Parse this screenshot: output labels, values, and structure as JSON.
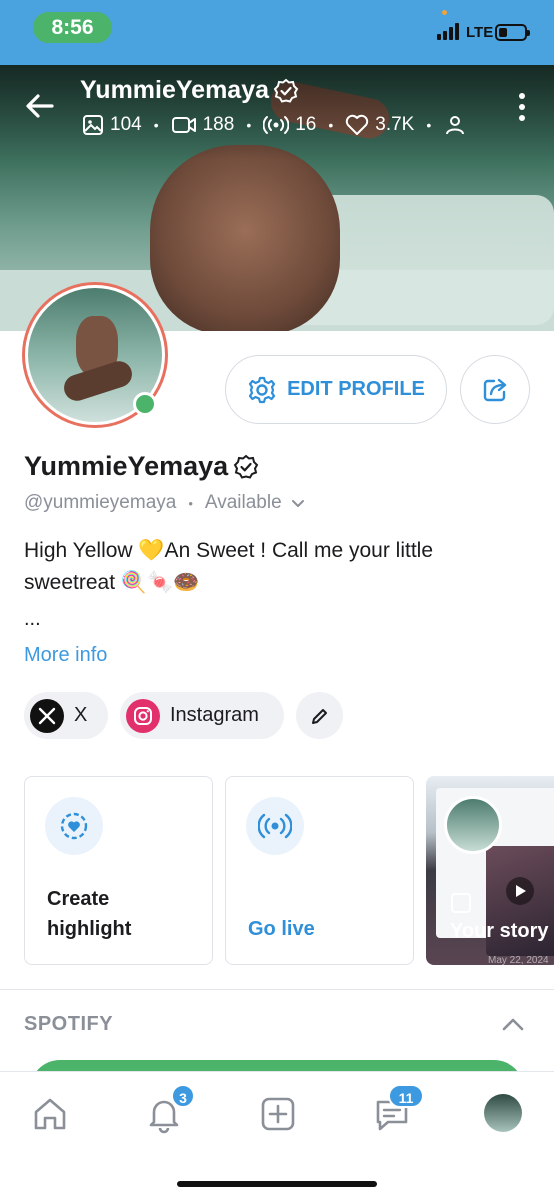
{
  "status_bar": {
    "time": "8:56",
    "network": "LTE"
  },
  "header": {
    "display_name": "YummieYemaya",
    "stats": {
      "photos": "104",
      "videos": "188",
      "streams": "16",
      "likes": "3.7K"
    }
  },
  "profile": {
    "display_name": "YummieYemaya",
    "handle": "@yummieyemaya",
    "availability": "Available",
    "bio_line1": "High Yellow 💛An Sweet ! Call me your little",
    "bio_line2": "sweetreat 🍭🍬🍩",
    "ellipsis": "...",
    "more_info": "More info",
    "edit_profile_label": "EDIT PROFILE"
  },
  "socials": [
    {
      "label": "X"
    },
    {
      "label": "Instagram"
    }
  ],
  "cards": {
    "highlight_line1": "Create",
    "highlight_line2": "highlight",
    "live": "Go live",
    "story": "Your story",
    "story_date": "May 22, 2024"
  },
  "spotify": {
    "title": "SPOTIFY"
  },
  "nav": {
    "notifications_badge": "3",
    "messages_badge": "11"
  },
  "colors": {
    "accent": "#2f8fd8",
    "online": "#4cb36a",
    "avatar_ring": "#e8705e",
    "instagram": "#e1306c"
  }
}
